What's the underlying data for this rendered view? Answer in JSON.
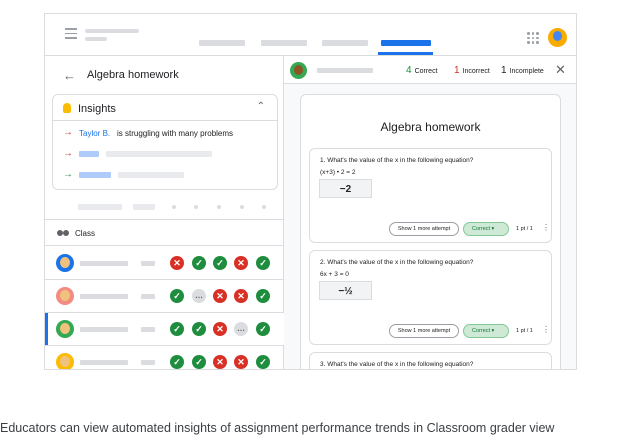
{
  "left_panel": {
    "back_icon": "arrow-left-icon",
    "title": "Algebra homework",
    "insights": {
      "title": "Insights",
      "items": [
        {
          "name": "Taylor B.",
          "text": "is struggling with many problems",
          "arrow_color": "#d93025"
        },
        {
          "arrow_color": "#d93025"
        },
        {
          "arrow_color": "#1e8e3e"
        }
      ]
    },
    "class_label": "Class",
    "students": [
      {
        "avatar_bg": "#1a73e8",
        "marks": [
          "incorrect",
          "correct",
          "correct",
          "incorrect",
          "correct"
        ]
      },
      {
        "avatar_bg": "#f28b82",
        "marks": [
          "correct",
          "pending",
          "incorrect",
          "incorrect",
          "correct"
        ]
      },
      {
        "avatar_bg": "#34a853",
        "selected": true,
        "marks": [
          "correct",
          "correct",
          "incorrect",
          "pending",
          "correct"
        ]
      },
      {
        "avatar_bg": "#fbbc04",
        "marks": [
          "correct",
          "correct",
          "incorrect",
          "incorrect",
          "correct"
        ]
      }
    ]
  },
  "right_panel": {
    "counts": [
      {
        "value": "4",
        "label": "Correct",
        "color": "#1e8e3e"
      },
      {
        "value": "1",
        "label": "Incorrect",
        "color": "#d93025"
      },
      {
        "value": "1",
        "label": "Incomplete",
        "color": "#202124"
      }
    ],
    "assignment_title": "Algebra homework",
    "questions": [
      {
        "text": "1. What's the value of the x in the following equation?",
        "equation": "(x+3) • 2 = 2",
        "answer": "−2",
        "show_more": "Show 1 more attempt",
        "status": "Correct",
        "points": "1 pt / 1"
      },
      {
        "text": "2. What's the value of the x in the following equation?",
        "equation": "6x + 3 = 0",
        "answer": "−½",
        "show_more": "Show 1 more attempt",
        "status": "Correct",
        "points": "1 pt / 1"
      },
      {
        "text": "3. What's the value of the x in the following equation?"
      }
    ]
  },
  "caption": "Educators can view automated insights of assignment performance trends in Classroom grader view",
  "colors": {
    "accent": "#1a73e8",
    "correct": "#1e8e3e",
    "incorrect": "#d93025"
  }
}
